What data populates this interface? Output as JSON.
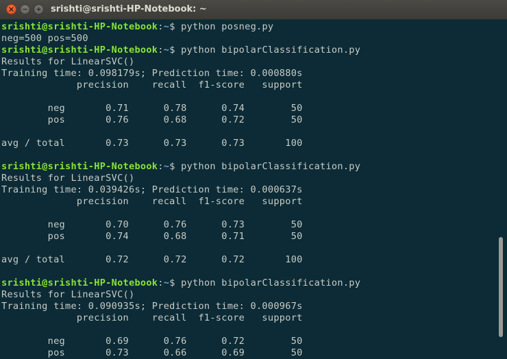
{
  "window": {
    "title": "srishti@srishti-HP-Notebook: ~"
  },
  "icons": {
    "close": "close-icon",
    "minimize": "minimize-icon",
    "maximize": "maximize-icon"
  },
  "colors": {
    "background": "#0c2b36",
    "text": "#c8ccc7",
    "prompt_user": "#8ae234",
    "prompt_path": "#729fcf",
    "close_button": "#df4a16"
  },
  "terminal": {
    "lines": [
      {
        "type": "prompt",
        "user": "srishti@srishti-HP-Notebook",
        "sep": ":",
        "path": "~",
        "sym": "$ ",
        "cmd": "python posneg.py"
      },
      {
        "type": "text",
        "text": "neg=500 pos=500"
      },
      {
        "type": "prompt",
        "user": "srishti@srishti-HP-Notebook",
        "sep": ":",
        "path": "~",
        "sym": "$ ",
        "cmd": "python bipolarClassification.py"
      },
      {
        "type": "text",
        "text": "Results for LinearSVC()"
      },
      {
        "type": "text",
        "text": "Training time: 0.098179s; Prediction time: 0.000880s"
      },
      {
        "type": "text",
        "text": "             precision    recall  f1-score   support"
      },
      {
        "type": "text",
        "text": ""
      },
      {
        "type": "text",
        "text": "        neg       0.71      0.78      0.74        50"
      },
      {
        "type": "text",
        "text": "        pos       0.76      0.68      0.72        50"
      },
      {
        "type": "text",
        "text": ""
      },
      {
        "type": "text",
        "text": "avg / total       0.73      0.73      0.73       100"
      },
      {
        "type": "text",
        "text": ""
      },
      {
        "type": "prompt",
        "user": "srishti@srishti-HP-Notebook",
        "sep": ":",
        "path": "~",
        "sym": "$ ",
        "cmd": "python bipolarClassification.py"
      },
      {
        "type": "text",
        "text": "Results for LinearSVC()"
      },
      {
        "type": "text",
        "text": "Training time: 0.039426s; Prediction time: 0.000637s"
      },
      {
        "type": "text",
        "text": "             precision    recall  f1-score   support"
      },
      {
        "type": "text",
        "text": ""
      },
      {
        "type": "text",
        "text": "        neg       0.70      0.76      0.73        50"
      },
      {
        "type": "text",
        "text": "        pos       0.74      0.68      0.71        50"
      },
      {
        "type": "text",
        "text": ""
      },
      {
        "type": "text",
        "text": "avg / total       0.72      0.72      0.72       100"
      },
      {
        "type": "text",
        "text": ""
      },
      {
        "type": "prompt",
        "user": "srishti@srishti-HP-Notebook",
        "sep": ":",
        "path": "~",
        "sym": "$ ",
        "cmd": "python bipolarClassification.py"
      },
      {
        "type": "text",
        "text": "Results for LinearSVC()"
      },
      {
        "type": "text",
        "text": "Training time: 0.090935s; Prediction time: 0.000967s"
      },
      {
        "type": "text",
        "text": "             precision    recall  f1-score   support"
      },
      {
        "type": "text",
        "text": ""
      },
      {
        "type": "text",
        "text": "        neg       0.69      0.76      0.72        50"
      },
      {
        "type": "text",
        "text": "        pos       0.73      0.66      0.69        50"
      }
    ]
  }
}
